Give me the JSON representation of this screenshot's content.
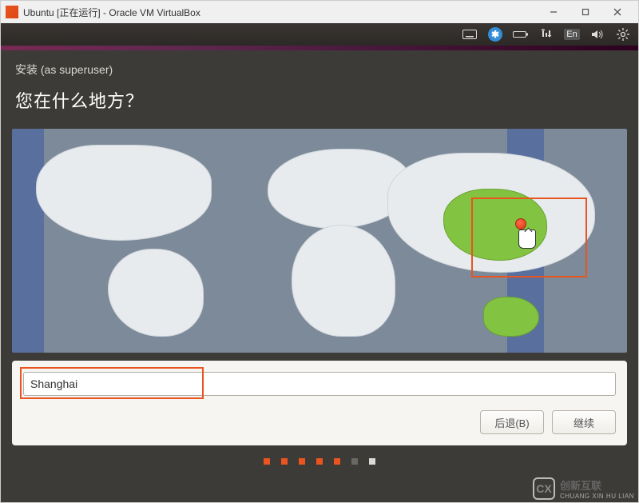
{
  "window": {
    "title": "Ubuntu [正在运行] - Oracle VM VirtualBox"
  },
  "menubar": {
    "language_indicator": "En"
  },
  "installer": {
    "subtitle": "安装 (as superuser)",
    "question": "您在什么地方？",
    "timezone_value": "Shanghai",
    "back_label": "后退(B)",
    "continue_label": "继续"
  },
  "pager": {
    "total": 7,
    "active_index": 5
  },
  "watermark": {
    "brand": "创新互联",
    "sub": "CHUANG XIN HU LIAN"
  }
}
